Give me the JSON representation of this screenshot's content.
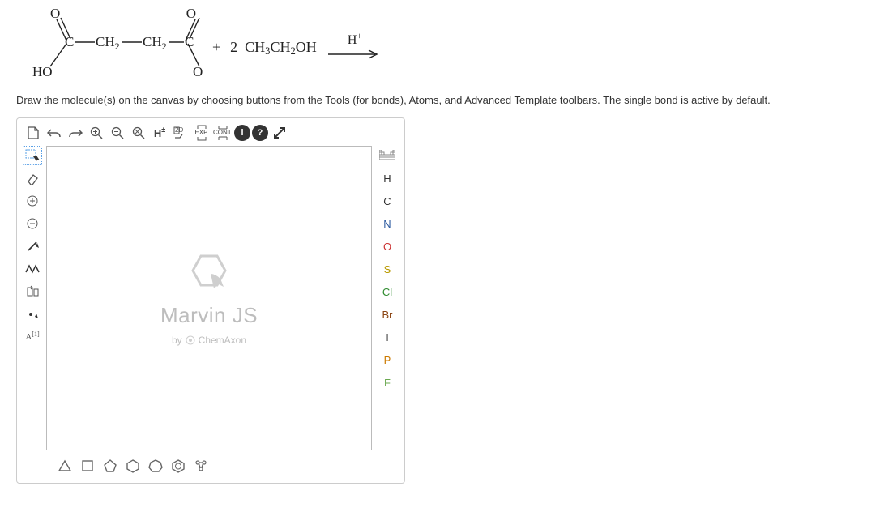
{
  "reaction": {
    "reagent_plus": "+",
    "reagent2_coeff": "2",
    "reagent2_html": "CH₃CH₂OH",
    "arrow_label": "H⁺"
  },
  "instructions": "Draw the molecule(s) on the canvas by choosing buttons from the Tools (for bonds), Atoms, and Advanced Template toolbars. The single bond is active by default.",
  "editor": {
    "top_toolbar": {
      "new": "New",
      "undo": "Undo",
      "redo": "Redo",
      "zoom_in": "Zoom in",
      "zoom_out": "Zoom out",
      "zoom_fit": "Zoom to fit",
      "h_toggle": "H±",
      "clean2d": "2D",
      "expand": "EXP.",
      "contract": "CONT.",
      "info": "i",
      "help": "?",
      "fullscreen": "Fullscreen"
    },
    "left_tools": {
      "select": "Rectangle selection",
      "erase": "Erase",
      "charge_plus": "Increase charge",
      "charge_minus": "Decrease charge",
      "single_bond": "Single bond",
      "chain": "Chain",
      "insert_text": "Insert text",
      "dot": "Dot",
      "abbrev": "A[1]"
    },
    "atoms": {
      "periodic": "Periodic",
      "H": {
        "label": "H",
        "color": "#333333"
      },
      "C": {
        "label": "C",
        "color": "#333333"
      },
      "N": {
        "label": "N",
        "color": "#2c5aa0"
      },
      "O": {
        "label": "O",
        "color": "#cc3333"
      },
      "S": {
        "label": "S",
        "color": "#b99a00"
      },
      "Cl": {
        "label": "Cl",
        "color": "#2e8b2e"
      },
      "Br": {
        "label": "Br",
        "color": "#8b4513"
      },
      "I": {
        "label": "I",
        "color": "#555555"
      },
      "P": {
        "label": "P",
        "color": "#cc7a00"
      },
      "F": {
        "label": "F",
        "color": "#6aa84f"
      }
    },
    "canvas": {
      "title": "Marvin JS",
      "subtitle_prefix": "by",
      "subtitle_brand": "ChemAxon"
    },
    "templates": {
      "cyclopropane": "Cyclopropane",
      "cyclobutane": "Cyclobutane",
      "cyclopentane": "Cyclopentane",
      "cyclohexane": "Cyclohexane",
      "cycloheptane": "Cycloheptane",
      "benzene": "Benzene",
      "more": "More templates"
    }
  }
}
